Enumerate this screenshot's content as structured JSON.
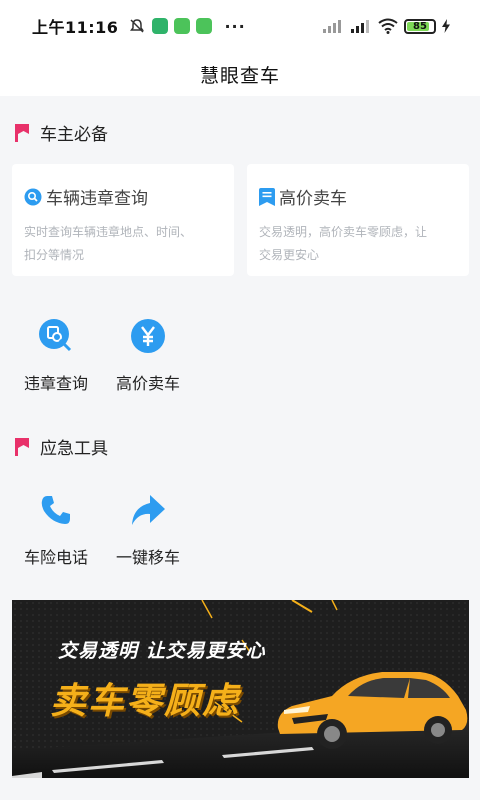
{
  "status_bar": {
    "time": "上午11:16",
    "battery": "85",
    "battery_level": 0.85,
    "more": "···"
  },
  "header": {
    "title": "慧眼查车"
  },
  "sections": {
    "owner": {
      "title": "车主必备"
    },
    "emergency": {
      "title": "应急工具"
    }
  },
  "cards": [
    {
      "title": "车辆违章查询",
      "desc_line1": "实时查询车辆违章地点、时间、",
      "desc_line2": "扣分等情况",
      "icon": "search-doc-icon"
    },
    {
      "title": "高价卖车",
      "desc_line1": "交易透明，高价卖车零顾虑，让",
      "desc_line2": "交易更安心",
      "icon": "document-icon"
    }
  ],
  "tools_owner": [
    {
      "label": "违章查询",
      "icon": "search-icon"
    },
    {
      "label": "高价卖车",
      "icon": "yuan-icon"
    }
  ],
  "tools_emergency": [
    {
      "label": "车险电话",
      "icon": "phone-icon"
    },
    {
      "label": "一键移车",
      "icon": "forward-arrow-icon"
    }
  ],
  "banner": {
    "line1": "交易透明 让交易更安心",
    "line2": "卖车零顾虑"
  },
  "colors": {
    "accent_blue": "#2d9cf0",
    "flag_red": "#e8316a",
    "banner_gold": "#f5b01a"
  }
}
